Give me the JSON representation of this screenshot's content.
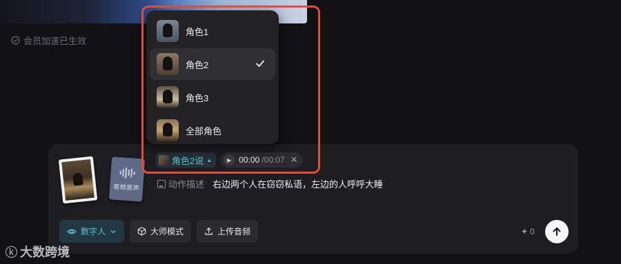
{
  "member_status": {
    "label": "会员加速已生效"
  },
  "role_menu": {
    "items": [
      {
        "label": "角色1",
        "selected": false
      },
      {
        "label": "角色2",
        "selected": true
      },
      {
        "label": "角色3",
        "selected": false
      },
      {
        "label": "全部角色",
        "selected": false
      }
    ]
  },
  "composer": {
    "audio_thumb_label": "音频原声",
    "speaker_chip": {
      "label": "角色2说"
    },
    "audio_chip": {
      "current": "00:00",
      "total": "/00:07"
    },
    "action": {
      "tag": "动作描述",
      "text": "右边两个人在窃窃私语，左边的人呼呼大睡"
    },
    "toolbar": {
      "digital_human": "数字人",
      "master_mode": "大师模式",
      "upload_audio": "上传音频"
    },
    "credit_count": "0"
  },
  "watermark": {
    "logo": "k",
    "text": "大数跨境"
  },
  "colors": {
    "accent": "#55c1c6",
    "highlight": "#e64a3c"
  }
}
